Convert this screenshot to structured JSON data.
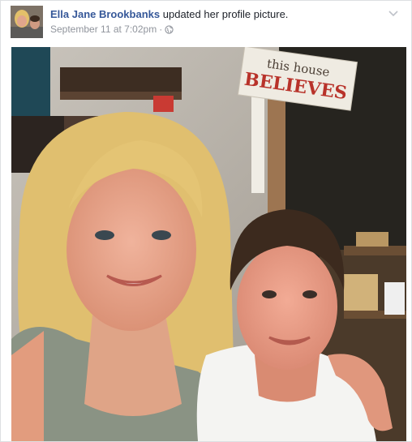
{
  "post": {
    "author": "Ella Jane Brookbanks",
    "action": "updated her profile picture.",
    "timestamp": "September 11 at 7:02pm",
    "separator": "·",
    "audience_icon": "globe-icon",
    "options_icon": "chevron-down-icon"
  },
  "photo": {
    "sign_line1": "this house",
    "sign_line2": "BELIEVES"
  },
  "colors": {
    "link": "#365899",
    "meta": "#90949c",
    "sign_red": "#b8322a"
  }
}
